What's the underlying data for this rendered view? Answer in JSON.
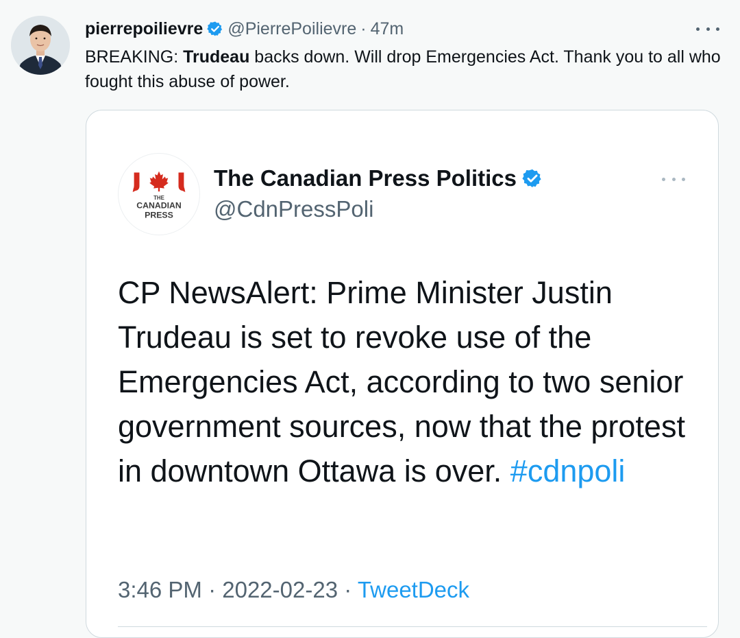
{
  "tweet": {
    "author_name": "pierrepoilievre",
    "author_handle": "@PierrePoilievre",
    "separator": "·",
    "time": "47m",
    "text_prefix": "BREAKING: ",
    "text_bold": "Trudeau",
    "text_suffix": " backs down. Will drop Emergencies Act. Thank you to all who fought this abuse of power.",
    "more_icon": "ellipsis-icon",
    "verified_icon": "verified-badge-icon"
  },
  "quoted_tweet": {
    "author_name": "The Canadian Press Politics",
    "author_handle": "@CdnPressPoli",
    "logo_text_line1": "THE",
    "logo_text_line2": "CANADIAN",
    "logo_text_line3": "PRESS",
    "text": "CP NewsAlert: Prime Minister Justin Trudeau is set to revoke use of the Emergencies Act, according to two senior government sources, now that the protest in downtown Ottawa is over. ",
    "hashtag": "#cdnpoli",
    "timestamp": "3:46 PM",
    "separator": "·",
    "date": "2022-02-23",
    "source": "TweetDeck"
  },
  "colors": {
    "link": "#1d9bf0",
    "verified": "#1d9bf0",
    "canada_red": "#d52b1e",
    "secondary_text": "#536471"
  }
}
